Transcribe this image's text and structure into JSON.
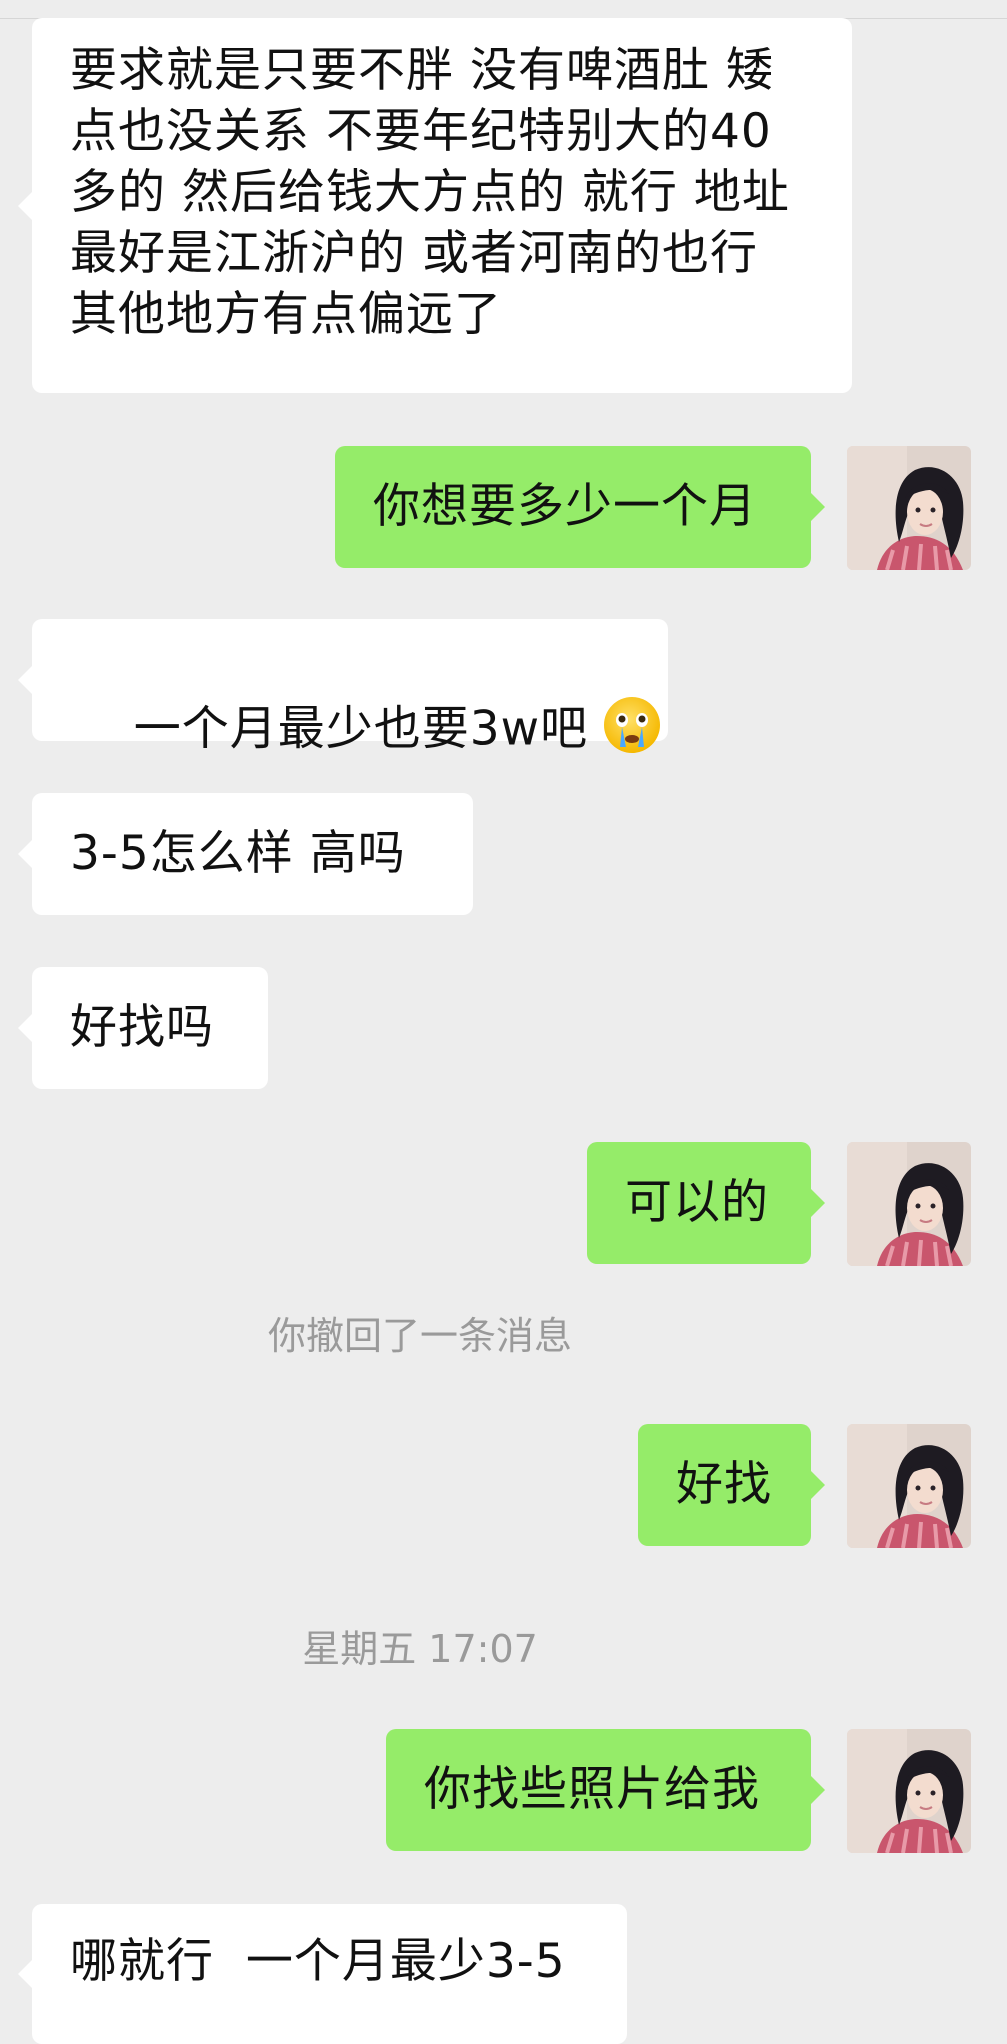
{
  "colors": {
    "background": "#ededed",
    "incoming_bubble": "#ffffff",
    "outgoing_bubble": "#95ec69",
    "system_text": "#9a9a9a"
  },
  "messages": [
    {
      "side": "in",
      "text": "要求就是只要不胖 没有啤酒肚 矮\n点也没关系 不要年纪特别大的40\n多的 然后给钱大方点的 就行 地址\n最好是江浙沪的 或者河南的也行\n其他地方有点偏远了"
    },
    {
      "side": "out",
      "text": "你想要多少一个月",
      "avatar": "user-avatar"
    },
    {
      "side": "in",
      "text": "一个月最少也要3w吧",
      "emoji": "crying-face-emoji"
    },
    {
      "side": "in",
      "text": "3-5怎么样 高吗"
    },
    {
      "side": "in",
      "text": "好找吗"
    },
    {
      "side": "out",
      "text": "可以的",
      "avatar": "user-avatar"
    },
    {
      "side": "system",
      "text": "你撤回了一条消息"
    },
    {
      "side": "out",
      "text": "好找",
      "avatar": "user-avatar"
    },
    {
      "side": "system",
      "text": "星期五 17:07"
    },
    {
      "side": "out",
      "text": "你找些照片给我",
      "avatar": "user-avatar"
    },
    {
      "side": "in",
      "text": "哪就行  一个月最少3-5"
    }
  ]
}
